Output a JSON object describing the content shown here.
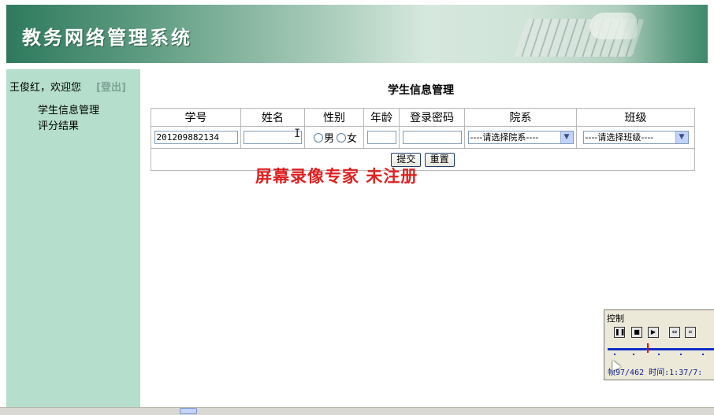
{
  "header": {
    "title": "教务网络管理系统"
  },
  "sidebar": {
    "welcome": "王俊红，欢迎您",
    "logout": "[登出]",
    "items": [
      {
        "label": "学生信息管理"
      },
      {
        "label": "评分结果"
      }
    ]
  },
  "main": {
    "title": "学生信息管理",
    "columns": [
      "学号",
      "姓名",
      "性别",
      "年龄",
      "登录密码",
      "院系",
      "班级"
    ],
    "fields": {
      "student_id": "201209882134",
      "name": "",
      "gender_options": [
        "男",
        "女"
      ],
      "age": "",
      "password": "",
      "department": "----请选择院系----",
      "class": "----请选择班级----"
    },
    "buttons": {
      "submit": "提交",
      "reset": "重置"
    }
  },
  "watermark": "屏幕录像专家  未注册",
  "recorder": {
    "title": "控制",
    "status": "帧97/462 时间:1:37/7:"
  }
}
